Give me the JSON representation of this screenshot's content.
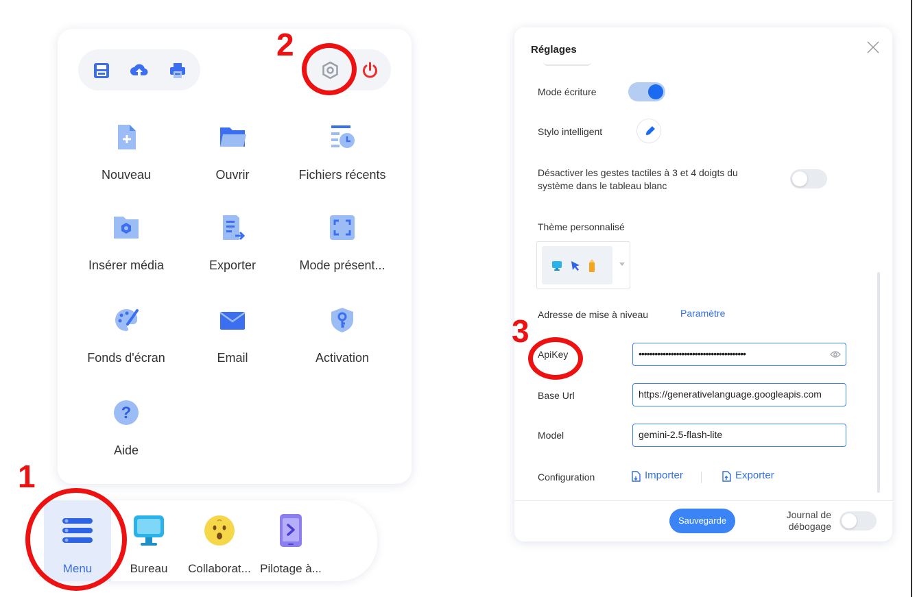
{
  "colors": {
    "accent": "#1a6bf0",
    "icon_blue": "#3b6ff0",
    "icon_light": "#a9c4f7",
    "annotation_red": "#ee1111",
    "power_red": "#ee2b2b"
  },
  "menu": {
    "toolbar": {
      "left_icons": [
        "save-icon",
        "cloud-upload-icon",
        "print-icon"
      ],
      "right_icons": [
        "settings-hexagon-icon",
        "power-icon"
      ]
    },
    "items": [
      {
        "label": "Nouveau",
        "icon": "new-file-icon"
      },
      {
        "label": "Ouvrir",
        "icon": "folder-open-icon"
      },
      {
        "label": "Fichiers récents",
        "icon": "recent-files-icon"
      },
      {
        "label": "Insérer média",
        "icon": "insert-media-icon"
      },
      {
        "label": "Exporter",
        "icon": "export-icon"
      },
      {
        "label": "Mode présent...",
        "icon": "fullscreen-icon"
      },
      {
        "label": "Fonds d'écran",
        "icon": "palette-icon"
      },
      {
        "label": "Email",
        "icon": "email-icon"
      },
      {
        "label": "Activation",
        "icon": "activation-shield-icon"
      },
      {
        "label": "Aide",
        "icon": "help-icon"
      }
    ]
  },
  "dock": {
    "items": [
      {
        "label": "Menu",
        "icon": "hamburger-menu-icon",
        "active": true
      },
      {
        "label": "Bureau",
        "icon": "desktop-monitor-icon"
      },
      {
        "label": "Collaborat...",
        "icon": "collaboration-emoji-icon"
      },
      {
        "label": "Pilotage à...",
        "icon": "phone-remote-icon"
      }
    ]
  },
  "settings": {
    "title": "Réglages",
    "writing_mode": {
      "label": "Mode écriture",
      "enabled": true
    },
    "smart_pen": {
      "label": "Stylo intelligent"
    },
    "disable_gestures": {
      "label": "Désactiver les gestes tactiles à 3 et 4 doigts du système dans le tableau blanc",
      "enabled": false
    },
    "custom_theme": {
      "label": "Thème personnalisé"
    },
    "upgrade_address": {
      "label": "Adresse de mise à niveau",
      "link": "Paramètre"
    },
    "api_key": {
      "label": "ApiKey",
      "value": "••••••••••••••••••••••••••••••••••••••••"
    },
    "base_url": {
      "label": "Base Url",
      "value": "https://generativelanguage.googleapis.com"
    },
    "model": {
      "label": "Model",
      "value": "gemini-2.5-flash-lite"
    },
    "configuration": {
      "label": "Configuration",
      "import": "Importer",
      "export": "Exporter"
    },
    "save_button": "Sauvegarde",
    "debug_log": {
      "label_line1": "Journal de",
      "label_line2": "débogage",
      "enabled": false
    }
  },
  "annotations": {
    "one": "1",
    "two": "2",
    "three": "3"
  }
}
